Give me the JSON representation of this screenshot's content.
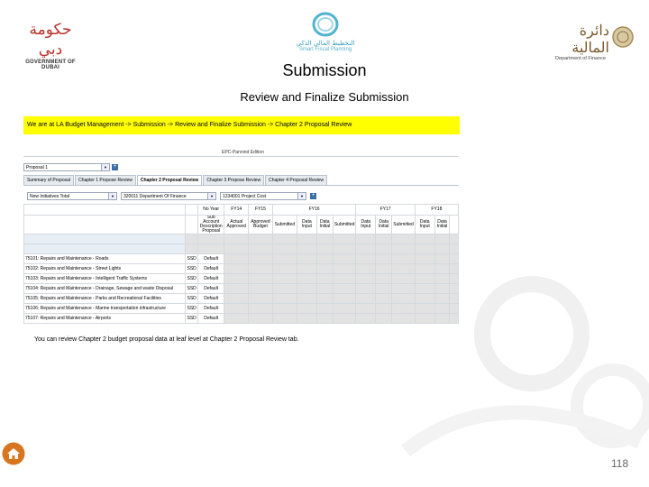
{
  "header": {
    "left_logo_ar": "حكومة دبي",
    "left_logo_en": "GOVERNMENT OF DUBAI",
    "center_logo_ar": "التخطيط المالي الذكي",
    "center_logo_en": "Smart Fiscal Planning",
    "right_logo_ar": "دائرة المالية",
    "right_logo_en": "Department of Finance"
  },
  "title": "Submission",
  "subtitle": "Review and Finalize Submission",
  "breadcrumb": "We are at LA Budget Management -> Submission -> Review and Finalize Submission -> Chapter 2 Proposal Review",
  "app": {
    "top_label": "EPC-Pannind Edition",
    "proposal_select": "Proposal 1",
    "tabs": [
      {
        "label": "Summary of Proposal",
        "active": false
      },
      {
        "label": "Chapter 1 Propose Review",
        "active": false
      },
      {
        "label": "Chapter 2 Proposal Review",
        "active": true
      },
      {
        "label": "Chapter 3 Propose Review",
        "active": false
      },
      {
        "label": "Chapter 4 Proposal Review",
        "active": false
      }
    ],
    "filters": [
      "New Initiatives Total",
      "320011 Department Of Finance",
      "1234001 Project Cost"
    ],
    "year_headers": [
      "FY14",
      "FY15",
      "FY16",
      "FY17",
      "FY18"
    ],
    "sub_headers": [
      "Sub Account Description Proposal",
      "Actual Approved",
      "Approved Budget",
      "Submitted",
      "Data Input",
      "Data Initial",
      "Submitted",
      "Data Input",
      "Data Initial",
      "Submitted",
      "Data Input",
      "Data Initial"
    ],
    "col_header_top": "No Year",
    "rows": [
      {
        "label": "75101: Repairs and Maintenance - Roads",
        "code": "SSD",
        "value": "Default"
      },
      {
        "label": "75102: Repairs and Maintenance - Street Lights",
        "code": "SSD",
        "value": "Default"
      },
      {
        "label": "75103: Repairs and Maintenance - Intelligent Traffic Systems",
        "code": "SSD",
        "value": "Default"
      },
      {
        "label": "75104: Repairs and Maintenance - Drainage, Sewage and waste Disposal",
        "code": "SSD",
        "value": "Default"
      },
      {
        "label": "75105: Repairs and Maintenance - Parks and Recreational Facilities",
        "code": "SSD",
        "value": "Default"
      },
      {
        "label": "75106: Repairs and Maintenance - Marine transportation infrastructure",
        "code": "SSD",
        "value": "Default"
      },
      {
        "label": "75107: Repairs and Maintenance - Airports",
        "code": "SSD",
        "value": "Default"
      }
    ]
  },
  "note": "You can review Chapter 2 budget proposal data at leaf level at Chapter 2 Proposal Review tab.",
  "page_number": "118"
}
